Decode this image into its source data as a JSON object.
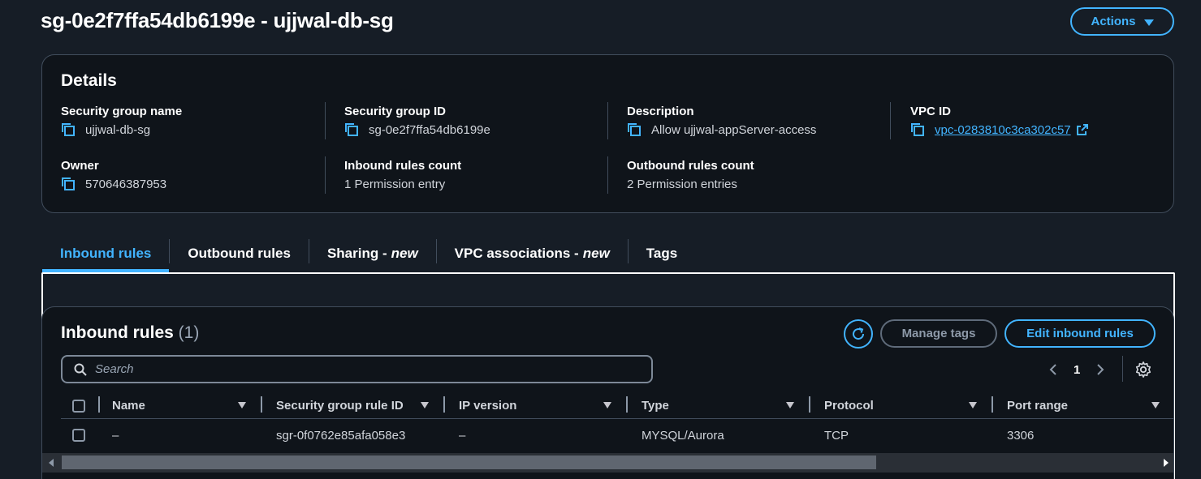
{
  "page": {
    "title": "sg-0e2f7ffa54db6199e - ujjwal-db-sg",
    "actions_label": "Actions"
  },
  "details": {
    "heading": "Details",
    "security_group_name": {
      "label": "Security group name",
      "value": "ujjwal-db-sg"
    },
    "security_group_id": {
      "label": "Security group ID",
      "value": "sg-0e2f7ffa54db6199e"
    },
    "description": {
      "label": "Description",
      "value": "Allow ujjwal-appServer-access"
    },
    "vpc_id": {
      "label": "VPC ID",
      "value": "vpc-0283810c3ca302c57"
    },
    "owner": {
      "label": "Owner",
      "value": "570646387953"
    },
    "inbound_rules_count": {
      "label": "Inbound rules count",
      "value": "1 Permission entry"
    },
    "outbound_rules_count": {
      "label": "Outbound rules count",
      "value": "2 Permission entries"
    }
  },
  "tabs": [
    {
      "label": "Inbound rules",
      "suffix": "",
      "active": true
    },
    {
      "label": "Outbound rules",
      "suffix": "",
      "active": false
    },
    {
      "label": "Sharing -",
      "suffix": "new",
      "active": false
    },
    {
      "label": "VPC associations -",
      "suffix": "new",
      "active": false
    },
    {
      "label": "Tags",
      "suffix": "",
      "active": false
    }
  ],
  "inbound_rules": {
    "heading": "Inbound rules",
    "count": "(1)",
    "manage_tags_label": "Manage tags",
    "edit_label": "Edit inbound rules",
    "search_placeholder": "Search",
    "current_page": "1",
    "columns": [
      "Name",
      "Security group rule ID",
      "IP version",
      "Type",
      "Protocol",
      "Port range"
    ],
    "rows": [
      {
        "name": "–",
        "rule_id": "sgr-0f0762e85afa058e3",
        "ip_version": "–",
        "type": "MYSQL/Aurora",
        "protocol": "TCP",
        "port_range": "3306"
      }
    ]
  },
  "colors": {
    "accent": "#42b4ff",
    "background": "#161d26",
    "panel": "#0f141a",
    "border": "#414d5c"
  },
  "icons": {
    "copy": "copy-icon",
    "external_link": "external-link-icon",
    "refresh": "refresh-icon",
    "search": "search-icon",
    "settings": "gear-icon"
  }
}
